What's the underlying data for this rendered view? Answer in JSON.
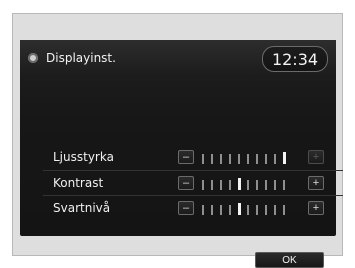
{
  "header": {
    "title": "Displayinst.",
    "time": "12:34",
    "icon": "gear-icon"
  },
  "settings": [
    {
      "label": "Ljusstyrka",
      "level": 10,
      "max": 10
    },
    {
      "label": "Kontrast",
      "level": 5,
      "max": 10
    },
    {
      "label": "Svartnivå",
      "level": 5,
      "max": 10
    }
  ],
  "buttons": {
    "minus": "–",
    "plus": "+",
    "ok": "OK"
  }
}
